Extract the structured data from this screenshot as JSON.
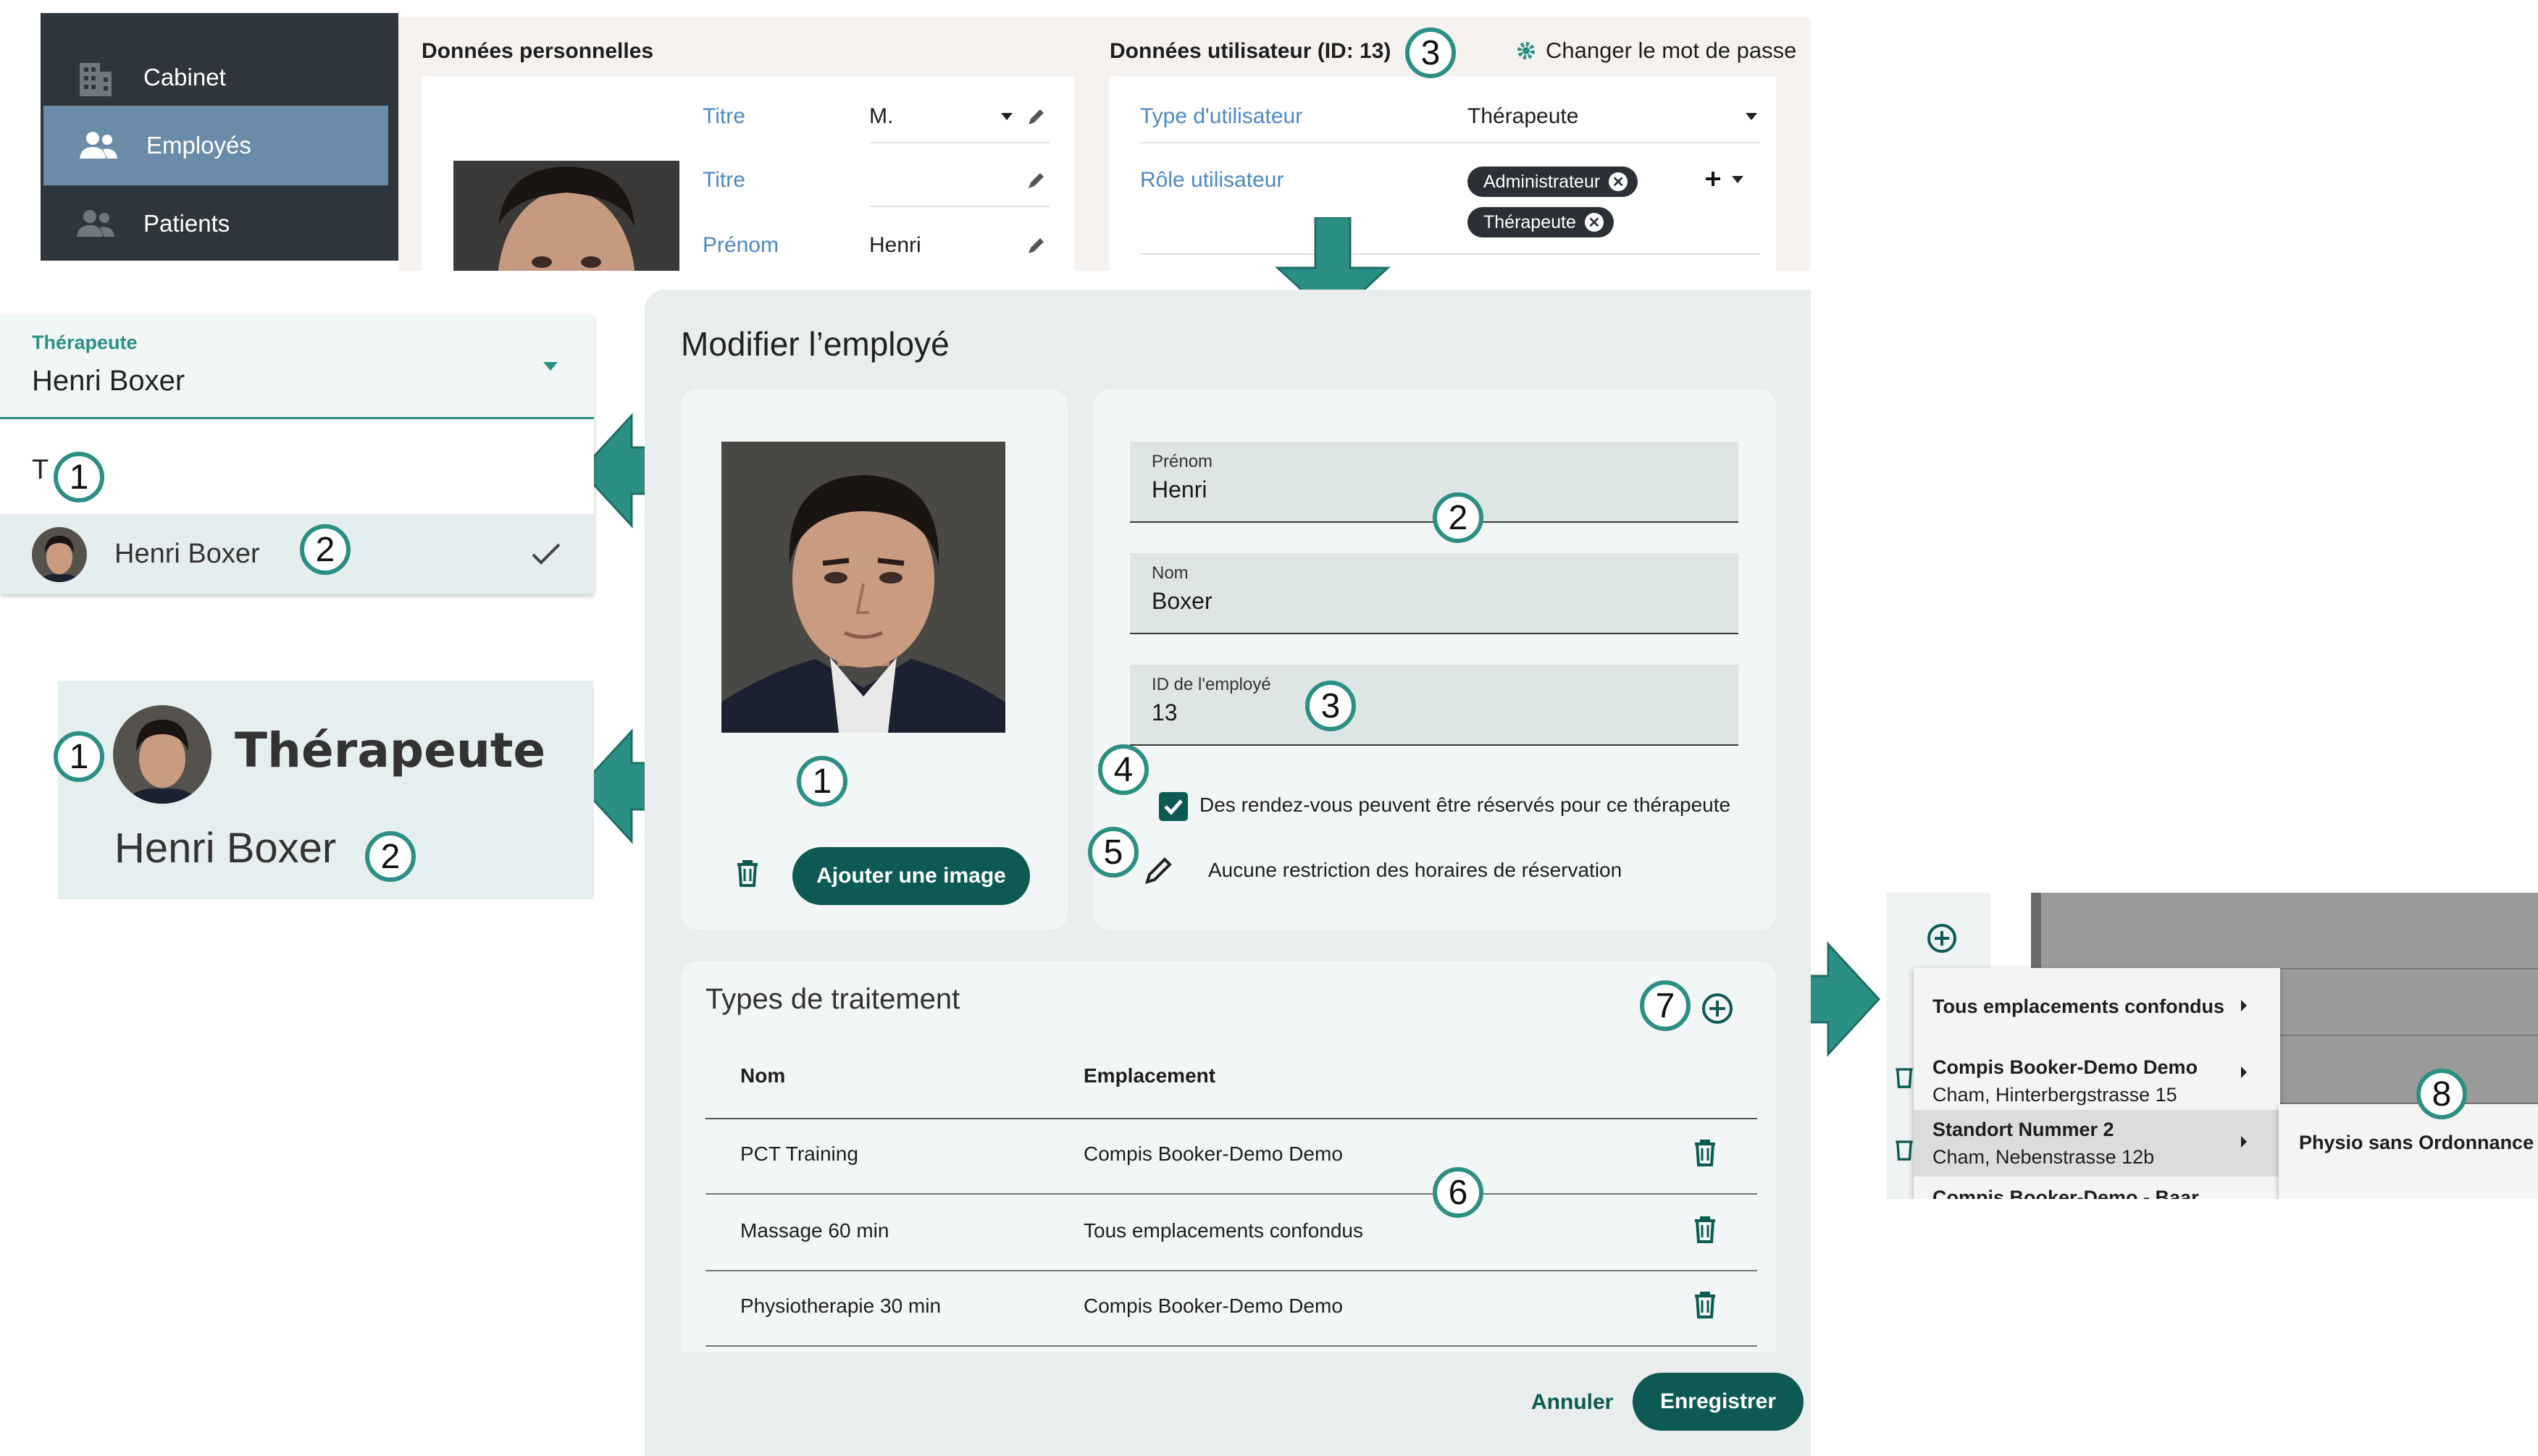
{
  "sidebar": {
    "items": [
      {
        "label": "Cabinet",
        "icon": "building-icon"
      },
      {
        "label": "Employés",
        "icon": "users-icon"
      },
      {
        "label": "Patients",
        "icon": "patients-icon"
      }
    ]
  },
  "personal": {
    "title": "Données personnelles",
    "fields": [
      {
        "label": "Titre",
        "value": "M."
      },
      {
        "label": "Titre",
        "value": ""
      },
      {
        "label": "Prénom",
        "value": "Henri"
      }
    ]
  },
  "user": {
    "title": "Données utilisateur (ID: 13)",
    "change_password": "Changer le mot de passe",
    "type_label": "Type d'utilisateur",
    "type_value": "Thérapeute",
    "role_label": "Rôle utilisateur",
    "roles": [
      "Administrateur",
      "Thérapeute"
    ]
  },
  "dropdown_panel": {
    "label": "Thérapeute",
    "value": "Henri Boxer",
    "search_text": "T",
    "option": "Henri Boxer"
  },
  "header_panel": {
    "role": "Thérapeute",
    "name": "Henri Boxer"
  },
  "dialog": {
    "title": "Modifier l’employé",
    "add_image": "Ajouter une image",
    "first_name_label": "Prénom",
    "first_name": "Henri",
    "last_name_label": "Nom",
    "last_name": "Boxer",
    "employee_id_label": "ID de l'employé",
    "employee_id": "13",
    "bookable_label": "Des rendez-vous peuvent être réservés pour ce thérapeute",
    "bookable_checked": true,
    "restriction_label": "Aucune restriction des horaires de réservation",
    "treatments": {
      "title": "Types de traitement",
      "columns": [
        "Nom",
        "Emplacement"
      ],
      "rows": [
        {
          "name": "PCT Training",
          "location": "Compis Booker-Demo Demo"
        },
        {
          "name": "Massage 60 min",
          "location": "Tous emplacements confondus"
        },
        {
          "name": "Physiotherapie 30 min",
          "location": "Compis Booker-Demo Demo"
        }
      ]
    },
    "cancel": "Annuler",
    "save": "Enregistrer"
  },
  "location_menu": {
    "items": [
      {
        "title": "Tous emplacements confondus",
        "sub": ""
      },
      {
        "title": "Compis Booker-Demo Demo",
        "sub": "Cham, Hinterbergstrasse 15"
      },
      {
        "title": "Standort Nummer 2",
        "sub": "Cham, Nebenstrasse 12b"
      },
      {
        "title": "Compis Booker-Demo - Baar",
        "sub": ""
      }
    ],
    "submenu": "Physio sans Ordonnance"
  },
  "callouts": [
    "1",
    "2",
    "3",
    "4",
    "5",
    "6",
    "7",
    "8"
  ],
  "colors": {
    "accent_teal": "#0c5a53",
    "callout_border": "#2c8f84",
    "sidebar_bg": "#2f353d",
    "sidebar_active": "#6a8ca8",
    "link_blue": "#4d89c0"
  }
}
